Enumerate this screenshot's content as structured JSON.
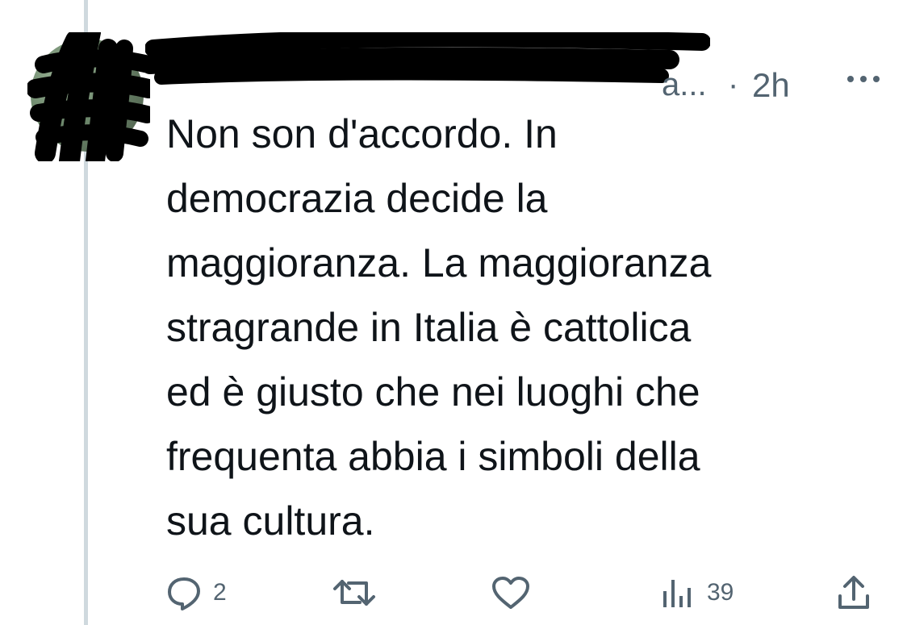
{
  "tweet": {
    "author": {
      "display_name": "[redacted]",
      "handle_visible_tail": "a...",
      "avatar_icon": "avatar-redacted"
    },
    "separator": "·",
    "time": "2h",
    "more_icon": "more-horizontal-icon",
    "text": "Non son d'accordo. In\ndemocrazia decide la\nmaggioranza. La maggioranza\nstragrande in Italia è cattolica\ned è giusto che nei luoghi che\nfrequenta abbia i simboli della\nsua cultura.",
    "actions": {
      "reply": {
        "icon": "reply-icon",
        "count": "2"
      },
      "retweet": {
        "icon": "retweet-icon",
        "count": ""
      },
      "like": {
        "icon": "heart-icon",
        "count": ""
      },
      "views": {
        "icon": "views-icon",
        "count": "39"
      },
      "share": {
        "icon": "share-icon"
      }
    }
  },
  "colors": {
    "text_primary": "#0f1419",
    "text_secondary": "#536471",
    "thread_line": "#cfd9de",
    "redaction": "#000000",
    "background": "#ffffff"
  }
}
